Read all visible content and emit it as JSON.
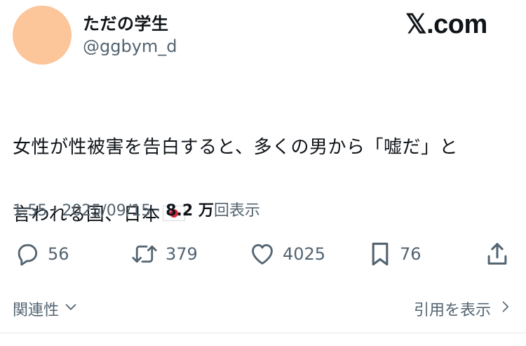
{
  "author": {
    "display_name": "ただの学生",
    "handle": "@ggbym_d",
    "avatar_color": "#fdc59a"
  },
  "brand": "𝕏.com",
  "tweet": {
    "line1": "女性が性被害を告白すると、多くの男から「嘘だ」と",
    "line2": "言われる国、日本",
    "flag_icon": "japan-flag"
  },
  "meta": {
    "time": "1:55",
    "separator": "·",
    "date": "2025/09/15",
    "views_number": "8.2 万",
    "views_label": "回表示"
  },
  "actions": {
    "replies": "56",
    "retweets": "379",
    "likes": "4025",
    "bookmarks": "76"
  },
  "footer": {
    "related_label": "関連性",
    "quotes_label": "引用を表示"
  },
  "colors": {
    "text": "#0f1419",
    "secondary": "#536471",
    "flag_red": "#d7263d"
  }
}
